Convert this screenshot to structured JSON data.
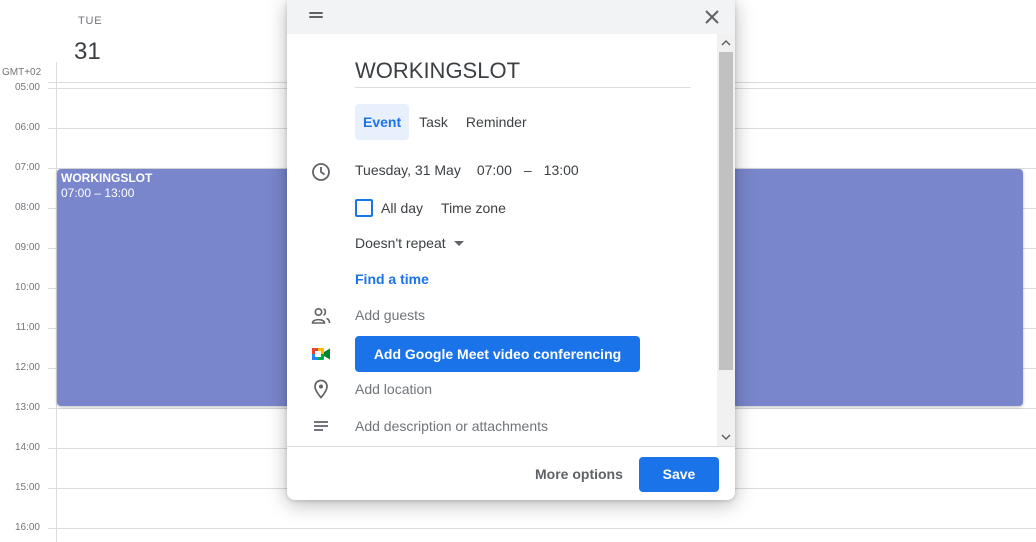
{
  "calendar": {
    "day_name": "TUE",
    "day_number": "31",
    "timezone": "GMT+02",
    "hours": [
      "05:00",
      "06:00",
      "07:00",
      "08:00",
      "09:00",
      "10:00",
      "11:00",
      "12:00",
      "13:00",
      "14:00",
      "15:00",
      "16:00"
    ],
    "event": {
      "title": "WORKINGSLOT",
      "time": "07:00 – 13:00",
      "color": "#7986cb"
    }
  },
  "dialog": {
    "title_value": "WORKINGSLOT",
    "tabs": [
      {
        "label": "Event",
        "active": true
      },
      {
        "label": "Task",
        "active": false
      },
      {
        "label": "Reminder",
        "active": false
      }
    ],
    "date": "Tuesday, 31 May",
    "start_time": "07:00",
    "dash": "–",
    "end_time": "13:00",
    "all_day_label": "All day",
    "all_day_checked": false,
    "time_zone_label": "Time zone",
    "repeat_label": "Doesn't repeat",
    "find_time_label": "Find a time",
    "guests_placeholder": "Add guests",
    "meet_label": "Add Google Meet video conferencing",
    "location_placeholder": "Add location",
    "description_placeholder": "Add description or attachments",
    "more_options_label": "More options",
    "save_label": "Save"
  },
  "colors": {
    "accent": "#1a73e8",
    "event": "#7986cb",
    "tab_active_bg": "#e8f0fe"
  }
}
